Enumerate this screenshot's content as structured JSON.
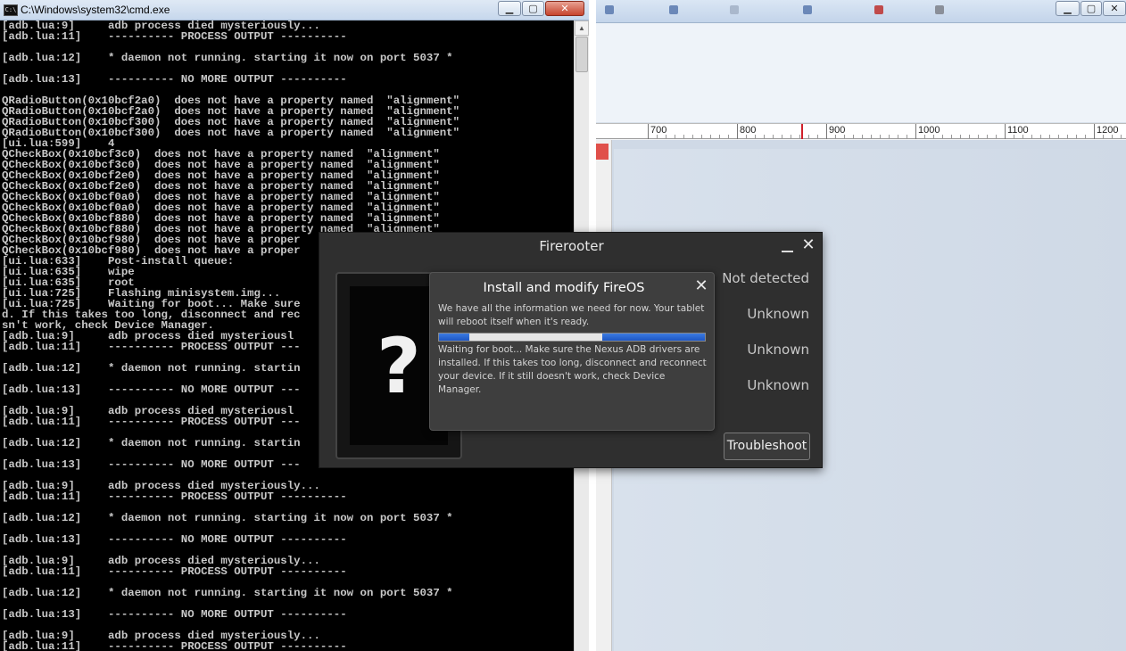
{
  "cmd": {
    "title": "C:\\Windows\\system32\\cmd.exe",
    "icon_text": "C:\\",
    "min_glyph": "▁",
    "max_glyph": "▢",
    "close_glyph": "✕",
    "scroll_up_glyph": "▲",
    "lines": [
      "[adb.lua:9]     adb process died mysteriously...",
      "[adb.lua:11]    ---------- PROCESS OUTPUT ----------",
      "",
      "[adb.lua:12]    * daemon not running. starting it now on port 5037 *",
      "",
      "[adb.lua:13]    ---------- NO MORE OUTPUT ----------",
      "",
      "QRadioButton(0x10bcf2a0)  does not have a property named  \"alignment\"",
      "QRadioButton(0x10bcf2a0)  does not have a property named  \"alignment\"",
      "QRadioButton(0x10bcf300)  does not have a property named  \"alignment\"",
      "QRadioButton(0x10bcf300)  does not have a property named  \"alignment\"",
      "[ui.lua:599]    4",
      "QCheckBox(0x10bcf3c0)  does not have a property named  \"alignment\"",
      "QCheckBox(0x10bcf3c0)  does not have a property named  \"alignment\"",
      "QCheckBox(0x10bcf2e0)  does not have a property named  \"alignment\"",
      "QCheckBox(0x10bcf2e0)  does not have a property named  \"alignment\"",
      "QCheckBox(0x10bcf0a0)  does not have a property named  \"alignment\"",
      "QCheckBox(0x10bcf0a0)  does not have a property named  \"alignment\"",
      "QCheckBox(0x10bcf880)  does not have a property named  \"alignment\"",
      "QCheckBox(0x10bcf880)  does not have a property named  \"alignment\"",
      "QCheckBox(0x10bcf980)  does not have a proper",
      "QCheckBox(0x10bcf980)  does not have a proper",
      "[ui.lua:633]    Post-install queue:",
      "[ui.lua:635]    wipe",
      "[ui.lua:635]    root",
      "[ui.lua:725]    Flashing minisystem.img...",
      "[ui.lua:725]    Waiting for boot... Make sure",
      "d. If this takes too long, disconnect and rec",
      "sn't work, check Device Manager.",
      "[adb.lua:9]     adb process died mysteriousl",
      "[adb.lua:11]    ---------- PROCESS OUTPUT ---",
      "",
      "[adb.lua:12]    * daemon not running. startin",
      "",
      "[adb.lua:13]    ---------- NO MORE OUTPUT ---",
      "",
      "[adb.lua:9]     adb process died mysteriousl",
      "[adb.lua:11]    ---------- PROCESS OUTPUT ---",
      "",
      "[adb.lua:12]    * daemon not running. startin",
      "",
      "[adb.lua:13]    ---------- NO MORE OUTPUT ---",
      "",
      "[adb.lua:9]     adb process died mysteriously...",
      "[adb.lua:11]    ---------- PROCESS OUTPUT ----------",
      "",
      "[adb.lua:12]    * daemon not running. starting it now on port 5037 *",
      "",
      "[adb.lua:13]    ---------- NO MORE OUTPUT ----------",
      "",
      "[adb.lua:9]     adb process died mysteriously...",
      "[adb.lua:11]    ---------- PROCESS OUTPUT ----------",
      "",
      "[adb.lua:12]    * daemon not running. starting it now on port 5037 *",
      "",
      "[adb.lua:13]    ---------- NO MORE OUTPUT ----------",
      "",
      "[adb.lua:9]     adb process died mysteriously...",
      "[adb.lua:11]    ---------- PROCESS OUTPUT ----------"
    ]
  },
  "right_window": {
    "min_glyph": "▁",
    "max_glyph": "▢",
    "close_glyph": "✕",
    "ruler_labels": [
      "700",
      "800",
      "900",
      "1000",
      "1100",
      "1200"
    ]
  },
  "firerooter": {
    "title": "Firerooter",
    "close_glyph": "✕",
    "tablet_glyph": "?",
    "statuses": [
      "Not detected",
      "Unknown",
      "Unknown",
      "Unknown"
    ],
    "troubleshoot_label": "Troubleshoot",
    "modal": {
      "title": "Install and modify FireOS",
      "close_glyph": "✕",
      "intro": "We have all the information we need for now. Your tablet will reboot itself when it's ready.",
      "status": "Waiting for boot... Make sure the Nexus ADB drivers are installed. If this takes too long, disconnect and reconnect your device. If it still doesn't work, check Device Manager."
    }
  }
}
